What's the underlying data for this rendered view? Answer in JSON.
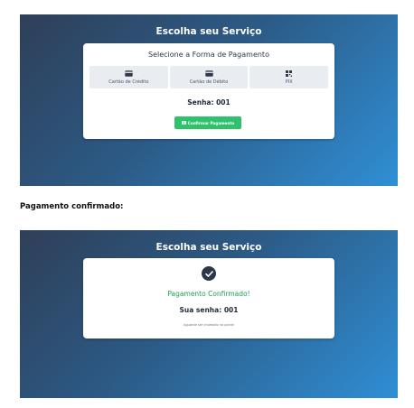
{
  "screen_one": {
    "title": "Escolha seu Serviço",
    "card_heading": "Selecione a Forma de Pagamento",
    "methods": [
      {
        "label": "Cartão de Crédito",
        "icon": "credit-card-icon"
      },
      {
        "label": "Cartão de Débito",
        "icon": "credit-card-icon"
      },
      {
        "label": "PIX",
        "icon": "qr-code-icon"
      }
    ],
    "senha": "Senha: 001",
    "confirm_button": "Confirmar Pagamento"
  },
  "section_label": "Pagamento confirmado:",
  "screen_two": {
    "title": "Escolha seu Serviço",
    "status_icon": "check-circle-icon",
    "confirmed_title": "Pagamento Confirmado!",
    "senha": "Sua senha: 001",
    "note": "Aguarde ser chamado no painel"
  },
  "colors": {
    "gradient_start": "#2f3f58",
    "gradient_end": "#2f8fd5",
    "confirm_button": "#2fc26c",
    "confirmed_text": "#1f9d55",
    "method_bg": "#e9edf2"
  }
}
